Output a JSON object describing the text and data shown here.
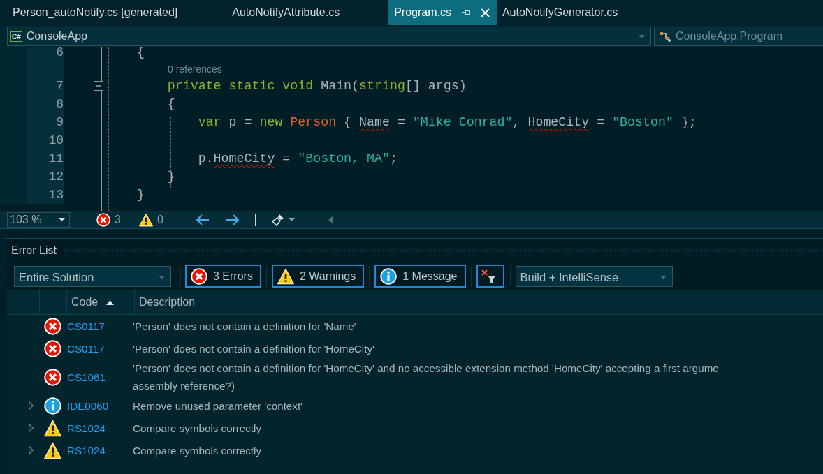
{
  "tabs": [
    {
      "label": "Person_autoNotify.cs [generated]",
      "selected": false
    },
    {
      "label": "AutoNotifyAttribute.cs",
      "selected": false
    },
    {
      "label": "Program.cs",
      "selected": true
    },
    {
      "label": "AutoNotifyGenerator.cs",
      "selected": false
    }
  ],
  "navigation": {
    "project_badge": "C#",
    "project": "ConsoleApp",
    "member": "ConsoleApp.Program"
  },
  "editor": {
    "lines": [
      {
        "number": "6",
        "foldable": false,
        "tokens": [
          {
            "text": "    {",
            "kind": "plain"
          }
        ]
      },
      {
        "number": "7",
        "foldable": true,
        "codelens": "0 references",
        "tokens": [
          {
            "text": "        private static void ",
            "kind": "keyword"
          },
          {
            "text": "Main(",
            "kind": "plain"
          },
          {
            "text": "string",
            "kind": "keyword"
          },
          {
            "text": "[] args)",
            "kind": "plain"
          }
        ]
      },
      {
        "number": "8",
        "foldable": false,
        "tokens": [
          {
            "text": "        {",
            "kind": "plain"
          }
        ]
      },
      {
        "number": "9",
        "foldable": false,
        "tokens": [
          {
            "text": "            var ",
            "kind": "keyword"
          },
          {
            "text": "p = ",
            "kind": "plain"
          },
          {
            "text": "new ",
            "kind": "keyword"
          },
          {
            "text": "Person",
            "kind": "type"
          },
          {
            "text": " { ",
            "kind": "plain"
          },
          {
            "text": "Name",
            "kind": "error"
          },
          {
            "text": " = ",
            "kind": "plain"
          },
          {
            "text": "\"Mike Conrad\"",
            "kind": "string"
          },
          {
            "text": ", ",
            "kind": "plain"
          },
          {
            "text": "HomeCity",
            "kind": "error"
          },
          {
            "text": " = ",
            "kind": "plain"
          },
          {
            "text": "\"Boston\"",
            "kind": "string"
          },
          {
            "text": " };",
            "kind": "plain"
          }
        ]
      },
      {
        "number": "10",
        "foldable": false
      },
      {
        "number": "11",
        "foldable": false,
        "tokens": [
          {
            "text": "            p.",
            "kind": "plain"
          },
          {
            "text": "HomeCity",
            "kind": "error"
          },
          {
            "text": " = ",
            "kind": "plain"
          },
          {
            "text": "\"Boston, MA\"",
            "kind": "string"
          },
          {
            "text": ";",
            "kind": "plain"
          }
        ]
      },
      {
        "number": "12",
        "foldable": false,
        "tokens": [
          {
            "text": "        }",
            "kind": "plain"
          }
        ]
      },
      {
        "number": "13",
        "foldable": false,
        "tokens": [
          {
            "text": "    }",
            "kind": "plain"
          }
        ]
      }
    ],
    "zoom": "103 %",
    "error_count": "3",
    "warning_count": "0"
  },
  "error_list": {
    "title": "Error List",
    "scope": "Entire Solution",
    "filters": [
      {
        "kind": "error",
        "label": "3 Errors",
        "selected": true
      },
      {
        "kind": "warning",
        "label": "2 Warnings",
        "selected": true
      },
      {
        "kind": "info",
        "label": "1 Message",
        "selected": true
      }
    ],
    "source": "Build + IntelliSense",
    "columns": [
      {
        "label": "Code",
        "sorted": true
      },
      {
        "label": "Description",
        "sorted": false
      }
    ],
    "rows": [
      {
        "kind": "error",
        "expandable": false,
        "code": "CS0117",
        "description": "'Person' does not contain a definition for 'Name'"
      },
      {
        "kind": "error",
        "expandable": false,
        "code": "CS0117",
        "description": "'Person' does not contain a definition for 'HomeCity'"
      },
      {
        "kind": "error",
        "expandable": false,
        "code": "CS1061",
        "description": "'Person' does not contain a definition for 'HomeCity' and no accessible extension method 'HomeCity' accepting a first argume\nassembly reference?)"
      },
      {
        "kind": "info",
        "expandable": true,
        "code": "IDE0060",
        "description": "Remove unused parameter 'context'"
      },
      {
        "kind": "warning",
        "expandable": true,
        "code": "RS1024",
        "description": "Compare symbols correctly"
      },
      {
        "kind": "warning",
        "expandable": true,
        "code": "RS1024",
        "description": "Compare symbols correctly"
      }
    ]
  }
}
